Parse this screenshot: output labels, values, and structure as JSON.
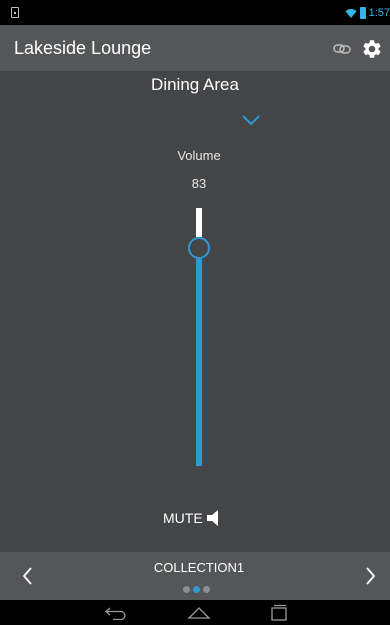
{
  "status_bar": {
    "time": "1:57",
    "icons": [
      "notification-icon",
      "wifi-icon",
      "battery-icon"
    ],
    "accent_color": "#33b5e5"
  },
  "action_bar": {
    "title": "Lakeside Lounge",
    "actions": [
      "link-icon",
      "gear-icon"
    ]
  },
  "zone": {
    "name": "Dining Area",
    "expand_icon": "chevron-down-icon"
  },
  "volume": {
    "label": "Volume",
    "value": "83",
    "level": 0.83,
    "accent_color": "#2e9ad4"
  },
  "mute": {
    "label": "MUTE",
    "icon": "speaker-icon"
  },
  "collection": {
    "name": "COLLECTION1",
    "pages": 3,
    "current_page": 2,
    "prev_icon": "chevron-left-icon",
    "next_icon": "chevron-right-icon"
  },
  "nav_bar": {
    "buttons": [
      "back-icon",
      "home-icon",
      "recents-icon"
    ]
  }
}
